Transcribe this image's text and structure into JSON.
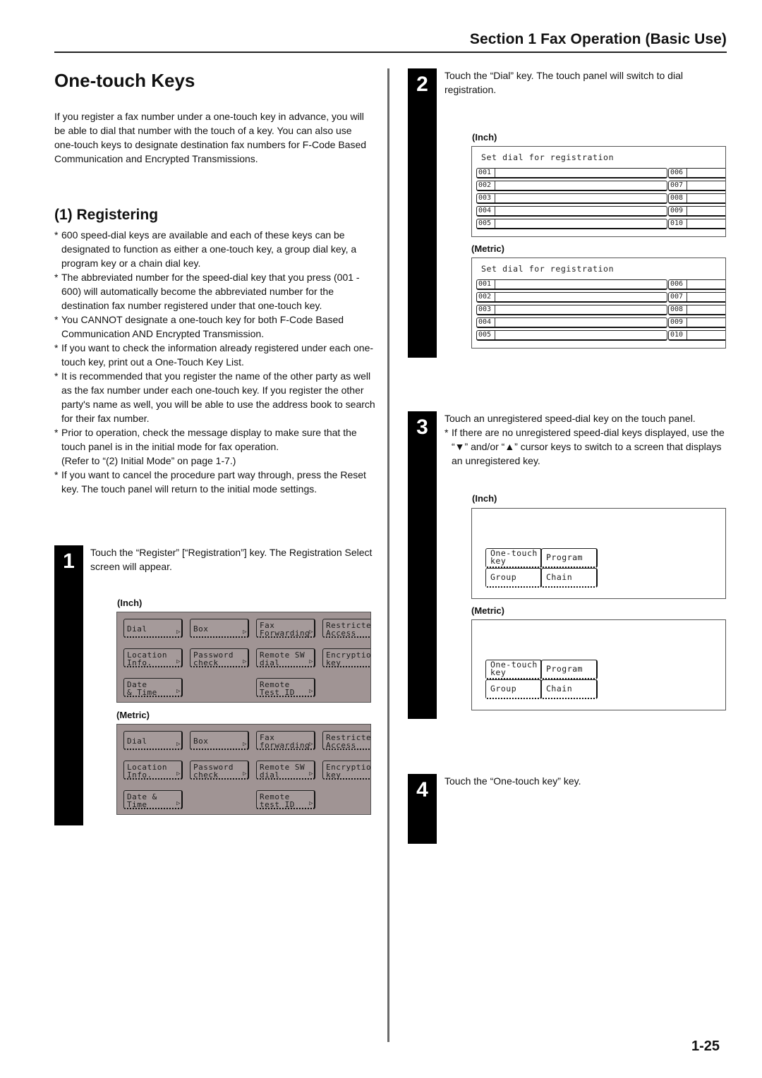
{
  "header": {
    "section_title": "Section 1  Fax Operation (Basic Use)"
  },
  "page": {
    "title": "One-touch Keys",
    "intro": "If you register a fax number under a one-touch key in advance, you will be able to dial that number with the touch of a key. You can also use one-touch keys to designate destination fax numbers for F-Code Based Communication and Encrypted Transmissions.",
    "subtitle": "(1) Registering",
    "notes": [
      {
        "bullet": "*",
        "text": "600 speed-dial keys are available and each of these keys can be designated to function as either a one-touch key, a group dial key, a program key or a chain dial key.",
        "extra": ""
      },
      {
        "bullet": "*",
        "text": "The abbreviated number for the speed-dial key that you press (001 - 600) will automatically become the abbreviated number for the destination fax number registered under that one-touch key.",
        "extra": ""
      },
      {
        "bullet": "*",
        "text": "You CANNOT designate a one-touch key for both F-Code Based Communication AND Encrypted Transmission.",
        "extra": ""
      },
      {
        "bullet": "*",
        "text": "If you want to check the information already registered under each one-touch key, print out a One-Touch Key List.",
        "extra": ""
      },
      {
        "bullet": "*",
        "text": "It is recommended that you register the name of the other party as well as the fax number under each one-touch key. If you register the other party's name as well, you will be able to use the address book to search for their fax number.",
        "extra": ""
      },
      {
        "bullet": "*",
        "text": "Prior to operation, check the message display to make sure that the touch panel is in the initial mode for fax operation.",
        "extra": "(Refer to “(2) Initial Mode” on page 1-7.)"
      },
      {
        "bullet": "*",
        "text": "If you want to cancel the procedure part way through, press the Reset key. The touch panel will return to the initial mode settings.",
        "extra": ""
      }
    ],
    "page_number": "1-25"
  },
  "steps": [
    {
      "number": "1",
      "text": "Touch the “Register” [“Registration”] key. The Registration Select screen will appear.",
      "captions": [
        "(Inch)",
        "(Metric)"
      ],
      "panels": {
        "inch": [
          [
            "Dial"
          ],
          [
            "Box"
          ],
          [
            "Fax",
            "Forwarding"
          ],
          [
            "Restricted",
            "Access"
          ],
          [
            "Location",
            "Info."
          ],
          [
            "Password",
            "check"
          ],
          [
            "Remote SW",
            "dial"
          ],
          [
            "Encryption",
            "key"
          ],
          [
            "Date",
            "& Time"
          ],
          [],
          [
            "Remote",
            "Test ID"
          ],
          []
        ],
        "metric": [
          [
            "Dial"
          ],
          [
            "Box"
          ],
          [
            "Fax",
            "forwarding"
          ],
          [
            "Restricted",
            "Access"
          ],
          [
            "Location",
            "Info."
          ],
          [
            "Password",
            "check"
          ],
          [
            "Remote SW",
            "dial"
          ],
          [
            "Encryption",
            "key"
          ],
          [
            "Date &",
            "Time"
          ],
          [],
          [
            "Remote",
            "test ID"
          ],
          []
        ],
        "arrow_icon": "▷"
      }
    },
    {
      "number": "2",
      "text": "Touch the “Dial” key. The touch panel will switch to dial registration.",
      "captions": [
        "(Inch)",
        "(Metric)"
      ],
      "dial_panel": {
        "title": "Set dial for registration",
        "left_keys": [
          "001",
          "002",
          "003",
          "004",
          "005"
        ],
        "right_keys": [
          "006",
          "007",
          "008",
          "009",
          "010"
        ]
      }
    },
    {
      "number": "3",
      "text": "Touch an unregistered speed-dial key on the touch panel.",
      "sub": "If there are no unregistered speed-dial keys displayed, use the “▼” and/or “▲” cursor keys to switch to a screen that displays an unregistered key.",
      "captions": [
        "(Inch)",
        "(Metric)"
      ],
      "type_panel": {
        "keys": [
          [
            "One-touch",
            "key"
          ],
          [
            "Program"
          ],
          [
            "Group"
          ],
          [
            "Chain"
          ]
        ]
      }
    },
    {
      "number": "4",
      "text": "Touch the “One-touch key” key."
    }
  ]
}
